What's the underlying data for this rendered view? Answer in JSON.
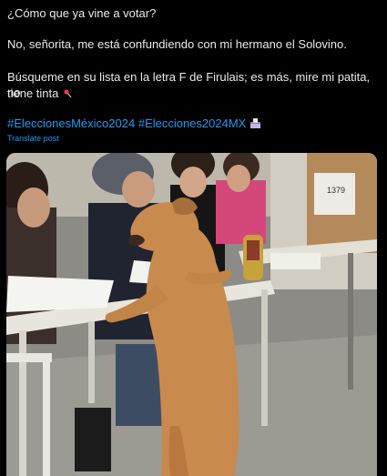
{
  "post": {
    "line1": "¿Cómo que ya vine a votar?",
    "line2": "No, señorita, me está confundiendo con mi hermano el Solovino.",
    "line3": "Búsqueme en su lista en la letra F de Firulais; es más, mire mi patita, no",
    "line4": "tiene tinta",
    "pin_icon": "pushpin-icon",
    "hashtags": [
      "#EleccionesMéxico2024",
      "#Elecciones2024MX"
    ],
    "ballot_icon": "ballot-box-icon",
    "translate_label": "Translate post"
  },
  "photo": {
    "sign_number": "1379",
    "subject": "dog-standing-at-polling-table"
  },
  "colors": {
    "background": "#000000",
    "text": "#e7e9ea",
    "link": "#1d9bf0"
  }
}
